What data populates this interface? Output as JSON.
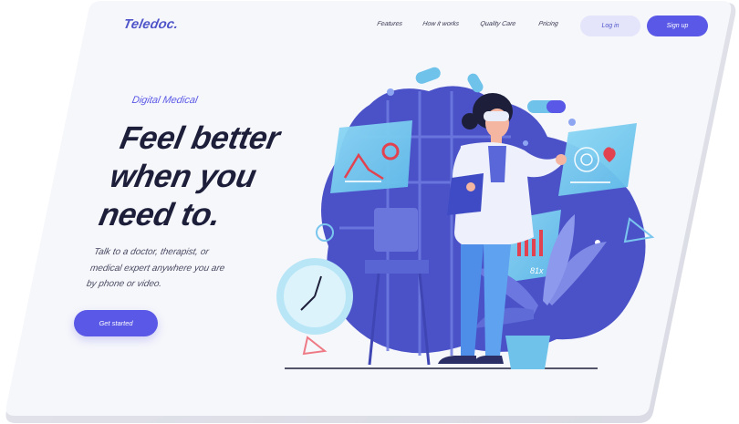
{
  "brand": {
    "logo": "Teledoc."
  },
  "nav": {
    "items": [
      "Features",
      "How it works",
      "Quality Care",
      "Pricing"
    ],
    "login_label": "Log in",
    "signup_label": "Sign up"
  },
  "hero": {
    "eyebrow": "Digital Medical",
    "headline": [
      "Feel better",
      "when you",
      "need to."
    ],
    "body": [
      "Talk to a doctor, therapist, or",
      "medical expert anywhere you are",
      "by phone or video."
    ],
    "cta_label": "Get started"
  },
  "illustration": {
    "chart_badge": "81x"
  },
  "colors": {
    "accent": "#5a58e6",
    "blob": "#4b52c8",
    "frame_bg": "#f6f7fb",
    "headline": "#1d1f3a"
  }
}
